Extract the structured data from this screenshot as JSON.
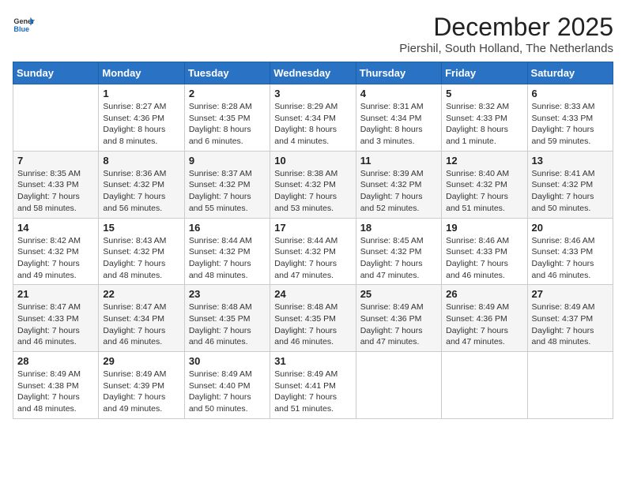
{
  "header": {
    "logo_general": "General",
    "logo_blue": "Blue",
    "month_title": "December 2025",
    "location": "Piershil, South Holland, The Netherlands"
  },
  "weekdays": [
    "Sunday",
    "Monday",
    "Tuesday",
    "Wednesday",
    "Thursday",
    "Friday",
    "Saturday"
  ],
  "weeks": [
    [
      {
        "day": "",
        "detail": ""
      },
      {
        "day": "1",
        "detail": "Sunrise: 8:27 AM\nSunset: 4:36 PM\nDaylight: 8 hours\nand 8 minutes."
      },
      {
        "day": "2",
        "detail": "Sunrise: 8:28 AM\nSunset: 4:35 PM\nDaylight: 8 hours\nand 6 minutes."
      },
      {
        "day": "3",
        "detail": "Sunrise: 8:29 AM\nSunset: 4:34 PM\nDaylight: 8 hours\nand 4 minutes."
      },
      {
        "day": "4",
        "detail": "Sunrise: 8:31 AM\nSunset: 4:34 PM\nDaylight: 8 hours\nand 3 minutes."
      },
      {
        "day": "5",
        "detail": "Sunrise: 8:32 AM\nSunset: 4:33 PM\nDaylight: 8 hours\nand 1 minute."
      },
      {
        "day": "6",
        "detail": "Sunrise: 8:33 AM\nSunset: 4:33 PM\nDaylight: 7 hours\nand 59 minutes."
      }
    ],
    [
      {
        "day": "7",
        "detail": "Sunrise: 8:35 AM\nSunset: 4:33 PM\nDaylight: 7 hours\nand 58 minutes."
      },
      {
        "day": "8",
        "detail": "Sunrise: 8:36 AM\nSunset: 4:32 PM\nDaylight: 7 hours\nand 56 minutes."
      },
      {
        "day": "9",
        "detail": "Sunrise: 8:37 AM\nSunset: 4:32 PM\nDaylight: 7 hours\nand 55 minutes."
      },
      {
        "day": "10",
        "detail": "Sunrise: 8:38 AM\nSunset: 4:32 PM\nDaylight: 7 hours\nand 53 minutes."
      },
      {
        "day": "11",
        "detail": "Sunrise: 8:39 AM\nSunset: 4:32 PM\nDaylight: 7 hours\nand 52 minutes."
      },
      {
        "day": "12",
        "detail": "Sunrise: 8:40 AM\nSunset: 4:32 PM\nDaylight: 7 hours\nand 51 minutes."
      },
      {
        "day": "13",
        "detail": "Sunrise: 8:41 AM\nSunset: 4:32 PM\nDaylight: 7 hours\nand 50 minutes."
      }
    ],
    [
      {
        "day": "14",
        "detail": "Sunrise: 8:42 AM\nSunset: 4:32 PM\nDaylight: 7 hours\nand 49 minutes."
      },
      {
        "day": "15",
        "detail": "Sunrise: 8:43 AM\nSunset: 4:32 PM\nDaylight: 7 hours\nand 48 minutes."
      },
      {
        "day": "16",
        "detail": "Sunrise: 8:44 AM\nSunset: 4:32 PM\nDaylight: 7 hours\nand 48 minutes."
      },
      {
        "day": "17",
        "detail": "Sunrise: 8:44 AM\nSunset: 4:32 PM\nDaylight: 7 hours\nand 47 minutes."
      },
      {
        "day": "18",
        "detail": "Sunrise: 8:45 AM\nSunset: 4:32 PM\nDaylight: 7 hours\nand 47 minutes."
      },
      {
        "day": "19",
        "detail": "Sunrise: 8:46 AM\nSunset: 4:33 PM\nDaylight: 7 hours\nand 46 minutes."
      },
      {
        "day": "20",
        "detail": "Sunrise: 8:46 AM\nSunset: 4:33 PM\nDaylight: 7 hours\nand 46 minutes."
      }
    ],
    [
      {
        "day": "21",
        "detail": "Sunrise: 8:47 AM\nSunset: 4:33 PM\nDaylight: 7 hours\nand 46 minutes."
      },
      {
        "day": "22",
        "detail": "Sunrise: 8:47 AM\nSunset: 4:34 PM\nDaylight: 7 hours\nand 46 minutes."
      },
      {
        "day": "23",
        "detail": "Sunrise: 8:48 AM\nSunset: 4:35 PM\nDaylight: 7 hours\nand 46 minutes."
      },
      {
        "day": "24",
        "detail": "Sunrise: 8:48 AM\nSunset: 4:35 PM\nDaylight: 7 hours\nand 46 minutes."
      },
      {
        "day": "25",
        "detail": "Sunrise: 8:49 AM\nSunset: 4:36 PM\nDaylight: 7 hours\nand 47 minutes."
      },
      {
        "day": "26",
        "detail": "Sunrise: 8:49 AM\nSunset: 4:36 PM\nDaylight: 7 hours\nand 47 minutes."
      },
      {
        "day": "27",
        "detail": "Sunrise: 8:49 AM\nSunset: 4:37 PM\nDaylight: 7 hours\nand 48 minutes."
      }
    ],
    [
      {
        "day": "28",
        "detail": "Sunrise: 8:49 AM\nSunset: 4:38 PM\nDaylight: 7 hours\nand 48 minutes."
      },
      {
        "day": "29",
        "detail": "Sunrise: 8:49 AM\nSunset: 4:39 PM\nDaylight: 7 hours\nand 49 minutes."
      },
      {
        "day": "30",
        "detail": "Sunrise: 8:49 AM\nSunset: 4:40 PM\nDaylight: 7 hours\nand 50 minutes."
      },
      {
        "day": "31",
        "detail": "Sunrise: 8:49 AM\nSunset: 4:41 PM\nDaylight: 7 hours\nand 51 minutes."
      },
      {
        "day": "",
        "detail": ""
      },
      {
        "day": "",
        "detail": ""
      },
      {
        "day": "",
        "detail": ""
      }
    ]
  ]
}
